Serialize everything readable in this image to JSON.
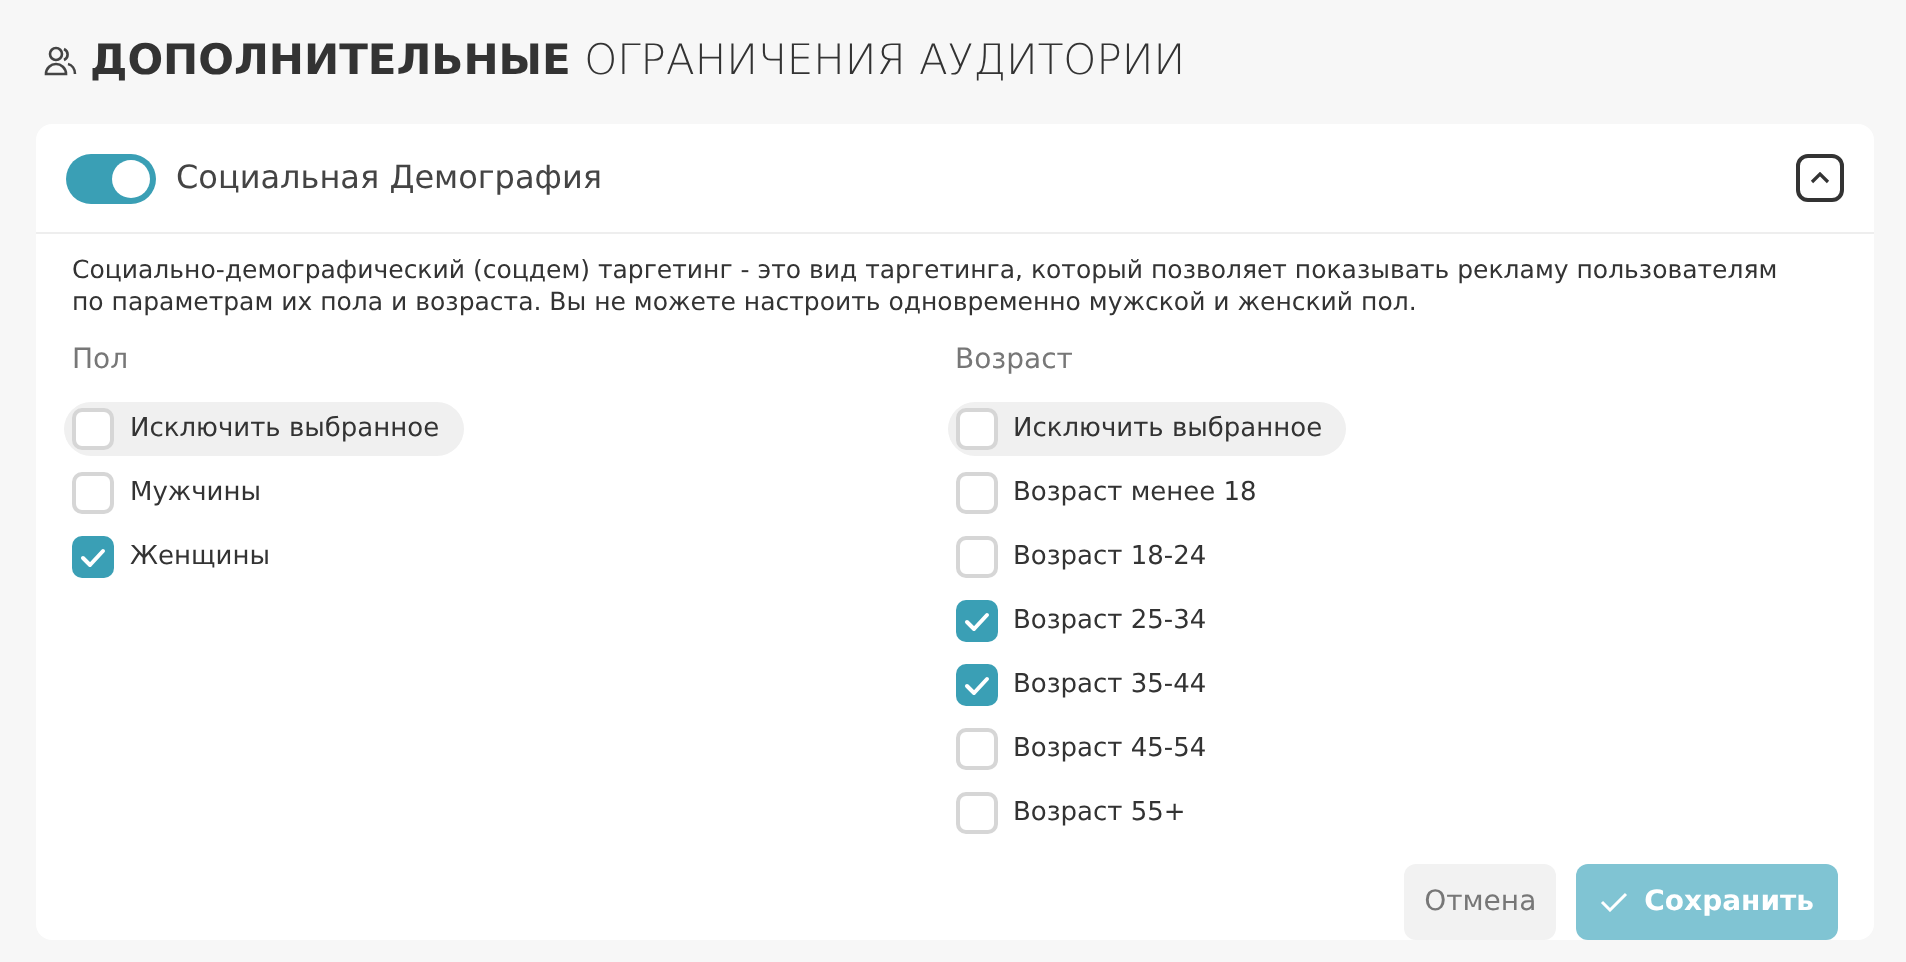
{
  "page_title": {
    "bold": "ДОПОЛНИТЕЛЬНЫЕ",
    "rest": "ОГРАНИЧЕНИЯ АУДИТОРИИ"
  },
  "section": {
    "title": "Социальная Демография",
    "enabled": true,
    "expanded": true,
    "description": "Социально-демографический (соцдем) таргетинг - это вид таргетинга, который позволяет показывать рекламу пользователям по параметрам их пола и возраста. Вы не можете настроить одновременно мужской и женский пол.",
    "groups": [
      {
        "title": "Пол",
        "options": [
          {
            "kind": "exclude",
            "label": "Исключить выбранное",
            "checked": false
          },
          {
            "kind": "option",
            "label": "Мужчины",
            "checked": false
          },
          {
            "kind": "option",
            "label": "Женщины",
            "checked": true
          }
        ]
      },
      {
        "title": "Возраст",
        "options": [
          {
            "kind": "exclude",
            "label": "Исключить выбранное",
            "checked": false
          },
          {
            "kind": "option",
            "label": "Возраст менее 18",
            "checked": false
          },
          {
            "kind": "option",
            "label": "Возраст 18-24",
            "checked": false
          },
          {
            "kind": "option",
            "label": "Возраст 25-34",
            "checked": true
          },
          {
            "kind": "option",
            "label": "Возраст 35-44",
            "checked": true
          },
          {
            "kind": "option",
            "label": "Возраст 45-54",
            "checked": false
          },
          {
            "kind": "option",
            "label": "Возраст 55+",
            "checked": false
          }
        ]
      }
    ],
    "buttons": [
      {
        "kind": "cancel",
        "label": "Отмена"
      },
      {
        "kind": "save",
        "label": "Сохранить"
      }
    ]
  }
}
